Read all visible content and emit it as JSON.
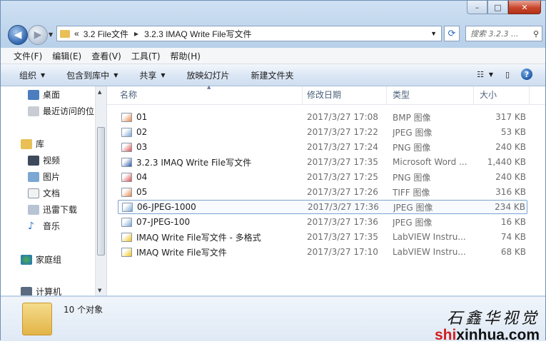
{
  "window": {
    "caption_buttons": {
      "minimize": "–",
      "maximize": "□",
      "close": "✕"
    }
  },
  "address": {
    "overflow": "«",
    "crumbs": [
      "3.2 File文件",
      "3.2.3 IMAQ Write File写文件"
    ],
    "search_placeholder": "搜索 3.2.3 ..."
  },
  "menu": [
    "文件(F)",
    "编辑(E)",
    "查看(V)",
    "工具(T)",
    "帮助(H)"
  ],
  "toolbar": {
    "organize": "组织",
    "include_in_library": "包含到库中",
    "share": "共享",
    "slideshow": "放映幻灯片",
    "new_folder": "新建文件夹"
  },
  "nav": {
    "items": [
      {
        "label": "桌面",
        "icon": "desktop-icon"
      },
      {
        "label": "最近访问的位",
        "icon": "recent-places-icon"
      },
      {
        "label": "库",
        "icon": "library-icon"
      },
      {
        "label": "视频",
        "icon": "video-icon"
      },
      {
        "label": "图片",
        "icon": "pictures-icon"
      },
      {
        "label": "文档",
        "icon": "documents-icon"
      },
      {
        "label": "迅雷下载",
        "icon": "download-icon"
      },
      {
        "label": "音乐",
        "icon": "music-icon"
      },
      {
        "label": "家庭组",
        "icon": "homegroup-icon"
      },
      {
        "label": "计算机",
        "icon": "computer-icon"
      }
    ]
  },
  "columns": {
    "name": "名称",
    "date": "修改日期",
    "type": "类型",
    "size": "大小"
  },
  "files": [
    {
      "name": "01",
      "date": "2017/3/27 17:08",
      "type": "BMP 图像",
      "size": "317 KB",
      "icon": "bmp-icon",
      "color": "#e8874a"
    },
    {
      "name": "02",
      "date": "2017/3/27 17:22",
      "type": "JPEG 图像",
      "size": "53 KB",
      "icon": "jpeg-icon",
      "color": "#7ba7d4"
    },
    {
      "name": "03",
      "date": "2017/3/27 17:24",
      "type": "PNG 图像",
      "size": "240 KB",
      "icon": "png-icon",
      "color": "#d9534f"
    },
    {
      "name": "3.2.3 IMAQ Write File写文件",
      "date": "2017/3/27 17:35",
      "type": "Microsoft Word ...",
      "size": "1,440 KB",
      "icon": "word-doc-icon",
      "color": "#2b5aa8"
    },
    {
      "name": "04",
      "date": "2017/3/27 17:25",
      "type": "PNG 图像",
      "size": "240 KB",
      "icon": "png-icon",
      "color": "#d9534f"
    },
    {
      "name": "05",
      "date": "2017/3/27 17:26",
      "type": "TIFF 图像",
      "size": "316 KB",
      "icon": "tiff-icon",
      "color": "#e8874a"
    },
    {
      "name": "06-JPEG-1000",
      "date": "2017/3/27 17:36",
      "type": "JPEG 图像",
      "size": "234 KB",
      "icon": "jpeg-icon",
      "color": "#7ba7d4"
    },
    {
      "name": "07-JPEG-100",
      "date": "2017/3/27 17:36",
      "type": "JPEG 图像",
      "size": "16 KB",
      "icon": "jpeg-icon",
      "color": "#7ba7d4"
    },
    {
      "name": "IMAQ Write File写文件 - 多格式",
      "date": "2017/3/27 17:35",
      "type": "LabVIEW Instru...",
      "size": "74 KB",
      "icon": "labview-vi-icon",
      "color": "#f0c419"
    },
    {
      "name": "IMAQ Write File写文件",
      "date": "2017/3/27 17:10",
      "type": "LabVIEW Instru...",
      "size": "68 KB",
      "icon": "labview-vi-icon",
      "color": "#f0c419"
    }
  ],
  "selected_index": 6,
  "status": {
    "count": "10 个对象"
  },
  "watermark": {
    "chinese": "石鑫华视觉",
    "url_red": "shi",
    "url_black": "xinhua.com"
  }
}
